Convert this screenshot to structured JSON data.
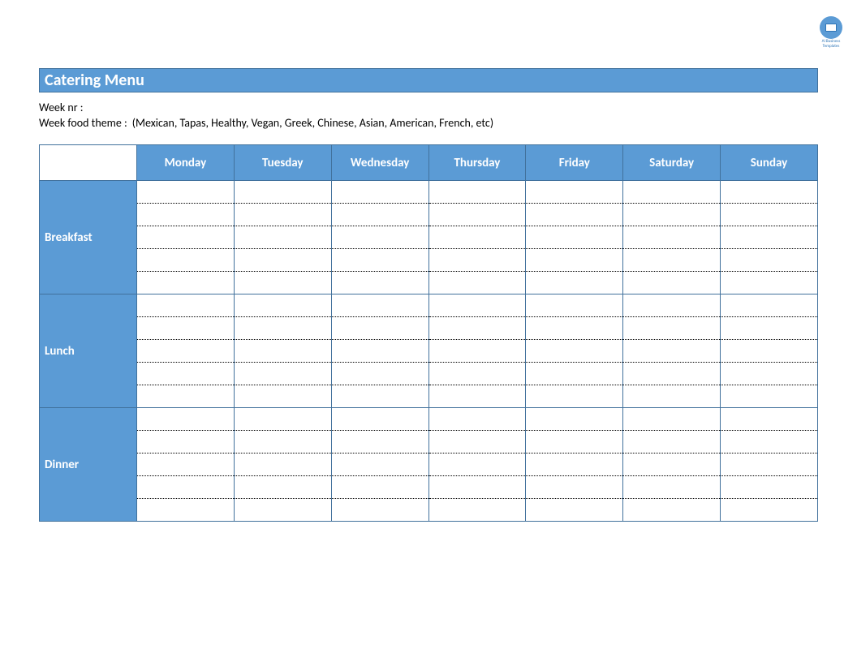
{
  "badge": {
    "line1": "Al Business",
    "line2": "Templates"
  },
  "title": "Catering Menu",
  "meta": {
    "week_nr_label": "Week nr :",
    "week_nr_value": "",
    "theme_label": "Week food theme :",
    "theme_value": "(Mexican, Tapas, Healthy, Vegan, Greek, Chinese, Asian, American, French, etc)"
  },
  "days": [
    "Monday",
    "Tuesday",
    "Wednesday",
    "Thursday",
    "Friday",
    "Saturday",
    "Sunday"
  ],
  "meals": [
    "Breakfast",
    "Lunch",
    "Dinner"
  ],
  "lines_per_cell": 5
}
